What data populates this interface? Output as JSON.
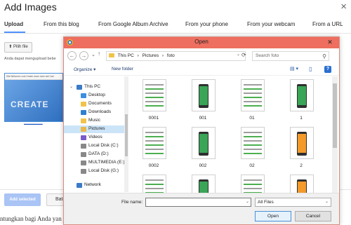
{
  "bg": {
    "title": "Add Images",
    "close": "×",
    "tabs": [
      {
        "label": "Upload"
      },
      {
        "label": "From this blog"
      },
      {
        "label": "From Google Album Archive"
      },
      {
        "label": "From your phone"
      },
      {
        "label": "From your webcam"
      },
      {
        "label": "From a URL"
      }
    ],
    "pick_files": "⬆ Pilih file",
    "description": "Anda dapat mengupload bebe",
    "thumb_strip": "Site  Welcome  Look  Create  Learn more  sell  Cart",
    "thumb_word": "CREATE",
    "thumb_caption": "____________",
    "add_selected": "Add selected",
    "cancel": "Bata",
    "bottom_text": "ntungkan bagi Anda yan"
  },
  "dialog": {
    "title": "Open",
    "close": "✕",
    "nav": {
      "back": "←",
      "forward": "→",
      "recent": "⌄",
      "up": "↑",
      "refresh": "⟳",
      "addr_dd": "⌄"
    },
    "address": [
      "This PC",
      "›",
      "Pictures",
      "›",
      "foto"
    ],
    "search_placeholder": "Search foto",
    "search_icon": "⚲",
    "toolbar": {
      "organize": "Organize ▾",
      "new_folder": "New folder",
      "view_icon": "▤ ▾",
      "pane_icon": "▯",
      "help": "?"
    },
    "sidebar": [
      {
        "label": "This PC",
        "icon": "pc-icon",
        "color": "#3b7ac8",
        "indent": 0,
        "chevron": "⌄"
      },
      {
        "label": "Desktop",
        "icon": "desktop-icon",
        "color": "#3b8ee0",
        "indent": 1
      },
      {
        "label": "Documents",
        "icon": "documents-icon",
        "color": "#f1c34a",
        "indent": 1
      },
      {
        "label": "Downloads",
        "icon": "downloads-icon",
        "color": "#2f7fd1",
        "indent": 1
      },
      {
        "label": "Music",
        "icon": "music-icon",
        "color": "#f1c34a",
        "indent": 1
      },
      {
        "label": "Pictures",
        "icon": "pictures-icon",
        "color": "#e8b64b",
        "indent": 1,
        "selected": true
      },
      {
        "label": "Videos",
        "icon": "videos-icon",
        "color": "#7a5bc8",
        "indent": 1
      },
      {
        "label": "Local Disk (C:)",
        "icon": "disk-icon",
        "color": "#888888",
        "indent": 1
      },
      {
        "label": "DATA (D:)",
        "icon": "disk-icon",
        "color": "#888888",
        "indent": 1
      },
      {
        "label": "MULTIMEDIA (E:)",
        "icon": "disk-icon",
        "color": "#888888",
        "indent": 1
      },
      {
        "label": "Local Disk (G:)",
        "icon": "disk-icon",
        "color": "#888888",
        "indent": 1
      },
      {
        "label": "Network",
        "icon": "network-icon",
        "color": "#3b7ac8",
        "indent": 0
      }
    ],
    "files": [
      {
        "name": "0001",
        "style": "list"
      },
      {
        "name": "001",
        "style": "green"
      },
      {
        "name": "01",
        "style": "list"
      },
      {
        "name": "1",
        "style": "green"
      },
      {
        "name": "0002",
        "style": "list"
      },
      {
        "name": "002",
        "style": "green"
      },
      {
        "name": "02",
        "style": "list"
      },
      {
        "name": "2",
        "style": "orange"
      },
      {
        "name": "",
        "style": "list"
      },
      {
        "name": "",
        "style": "green"
      },
      {
        "name": "",
        "style": "list"
      },
      {
        "name": "",
        "style": "orange"
      }
    ],
    "file_name_label": "File name:",
    "file_name_value": "",
    "file_name_dd": "⌄",
    "file_type": "All Files",
    "file_type_dd": "⌄",
    "open": "Open",
    "cancel": "Cancel"
  }
}
